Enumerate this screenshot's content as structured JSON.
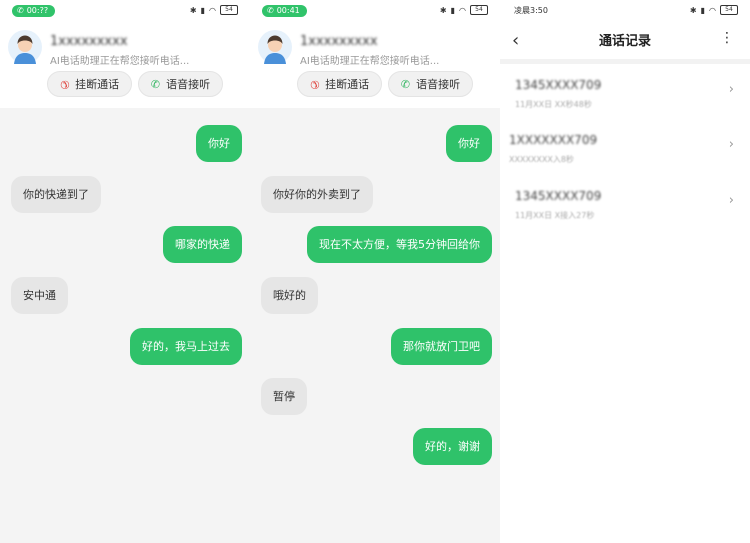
{
  "panel1": {
    "status": {
      "call_timer": "00:??",
      "battery": "54"
    },
    "caller": {
      "name": "1xxxxxxxxx",
      "subtitle": "AI电话助理正在帮您接听电话..."
    },
    "buttons": {
      "hangup": "挂断通话",
      "voice": "语音接听"
    },
    "messages": [
      {
        "side": "me",
        "text": "你好"
      },
      {
        "side": "them",
        "text": "你的快递到了"
      },
      {
        "side": "me",
        "text": "哪家的快递"
      },
      {
        "side": "them",
        "text": "安中通"
      },
      {
        "side": "me",
        "text": "好的，我马上过去"
      }
    ]
  },
  "panel2": {
    "status": {
      "call_timer": "00:41",
      "battery": "54"
    },
    "caller": {
      "name": "1xxxxxxxxx",
      "subtitle": "AI电话助理正在帮您接听电话..."
    },
    "buttons": {
      "hangup": "挂断通话",
      "voice": "语音接听"
    },
    "messages": [
      {
        "side": "me",
        "text": "你好"
      },
      {
        "side": "them",
        "text": "你好你的外卖到了"
      },
      {
        "side": "me",
        "text": "现在不太方便，等我5分钟回给你"
      },
      {
        "side": "them",
        "text": "哦好的"
      },
      {
        "side": "me",
        "text": "那你就放门卫吧"
      },
      {
        "side": "them",
        "text": "暂停"
      },
      {
        "side": "me",
        "text": "好的，谢谢"
      }
    ]
  },
  "panel3": {
    "status": {
      "time": "凌晨3:50",
      "battery": "54"
    },
    "header": {
      "title": "通话记录"
    },
    "records": [
      {
        "number": "1345XXXX709",
        "meta": "11月XX日 XX秒48秒"
      },
      {
        "number": "1XXXXXXX709",
        "meta": "XXXXXXXX入8秒"
      },
      {
        "number": "1345XXXX709",
        "meta": "11月XX日 X接入27秒"
      }
    ]
  },
  "colors": {
    "green": "#2fc26a",
    "red": "#e0413b",
    "bg": "#f4f4f4"
  },
  "icons": {
    "back": "chevron-left-icon",
    "more": "more-vertical-icon",
    "row": "chevron-right-icon"
  }
}
